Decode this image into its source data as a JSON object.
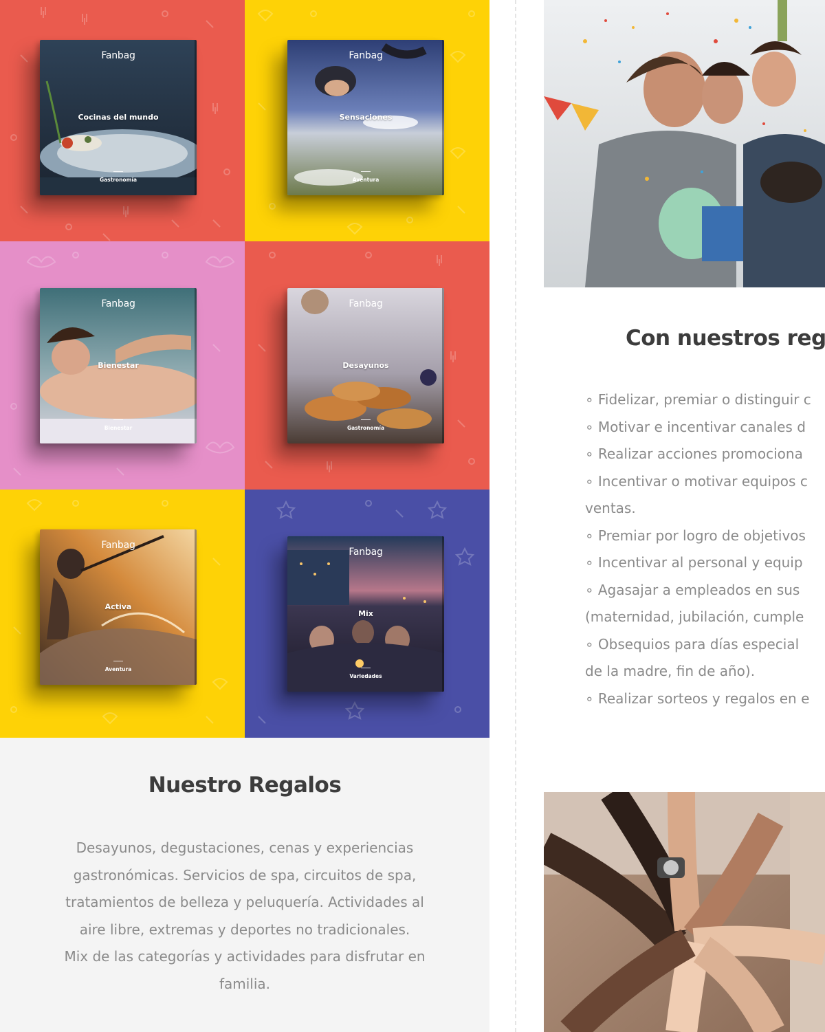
{
  "products": [
    {
      "brand": "Fanbag",
      "title": "Cocinas del mundo",
      "subtitle": "Gastronomía",
      "tile_color": "#ea5b4e",
      "photo": "fine-dining-plate-photo"
    },
    {
      "brand": "Fanbag",
      "title": "Sensaciones",
      "subtitle": "Aventura",
      "tile_color": "#fed206",
      "photo": "skydiving-photo"
    },
    {
      "brand": "Fanbag",
      "title": "Bienestar",
      "subtitle": "Bienestar",
      "tile_color": "#e58fc8",
      "photo": "massage-photo"
    },
    {
      "brand": "Fanbag",
      "title": "Desayunos",
      "subtitle": "Gastronomía",
      "tile_color": "#ea5b4e",
      "photo": "croissants-breakfast-photo"
    },
    {
      "brand": "Fanbag",
      "title": "Activa",
      "subtitle": "Aventura",
      "tile_color": "#fed206",
      "photo": "kayak-rapids-photo"
    },
    {
      "brand": "Fanbag",
      "title": "Mix",
      "subtitle": "Variedades",
      "tile_color": "#4a4fa6",
      "photo": "friends-rooftop-night-photo"
    }
  ],
  "left_section": {
    "title": "Nuestro Regalos",
    "description_lines": [
      "Desayunos, degustaciones, cenas y experiencias",
      "gastronómicas. Servicios de spa, circuitos de spa,",
      "tratamientos de belleza y peluquería. Actividades al",
      "aire libre, extremas y deportes no tradicionales.",
      "Mix de las categorías y actividades para disfrutar en",
      "familia."
    ]
  },
  "right_section": {
    "title": "Con nuestros reg",
    "benefit_lines": [
      "∘ Fidelizar, premiar o distinguir c",
      "∘ Motivar e incentivar canales d",
      "∘ Realizar acciones promociona",
      "∘ Incentivar o motivar equipos c",
      "ventas.",
      "∘ Premiar por logro de objetivos",
      "∘ Incentivar al personal y equip",
      "∘ Agasajar a empleados en sus",
      "(maternidad, jubilación, cumple",
      "∘ Obsequios para días especial",
      "de la madre, fin de año).",
      "∘ Realizar sorteos y regalos en e"
    ],
    "photo_top": "birthday-party-celebration-photo",
    "photo_bottom": "team-hands-stacked-photo"
  }
}
